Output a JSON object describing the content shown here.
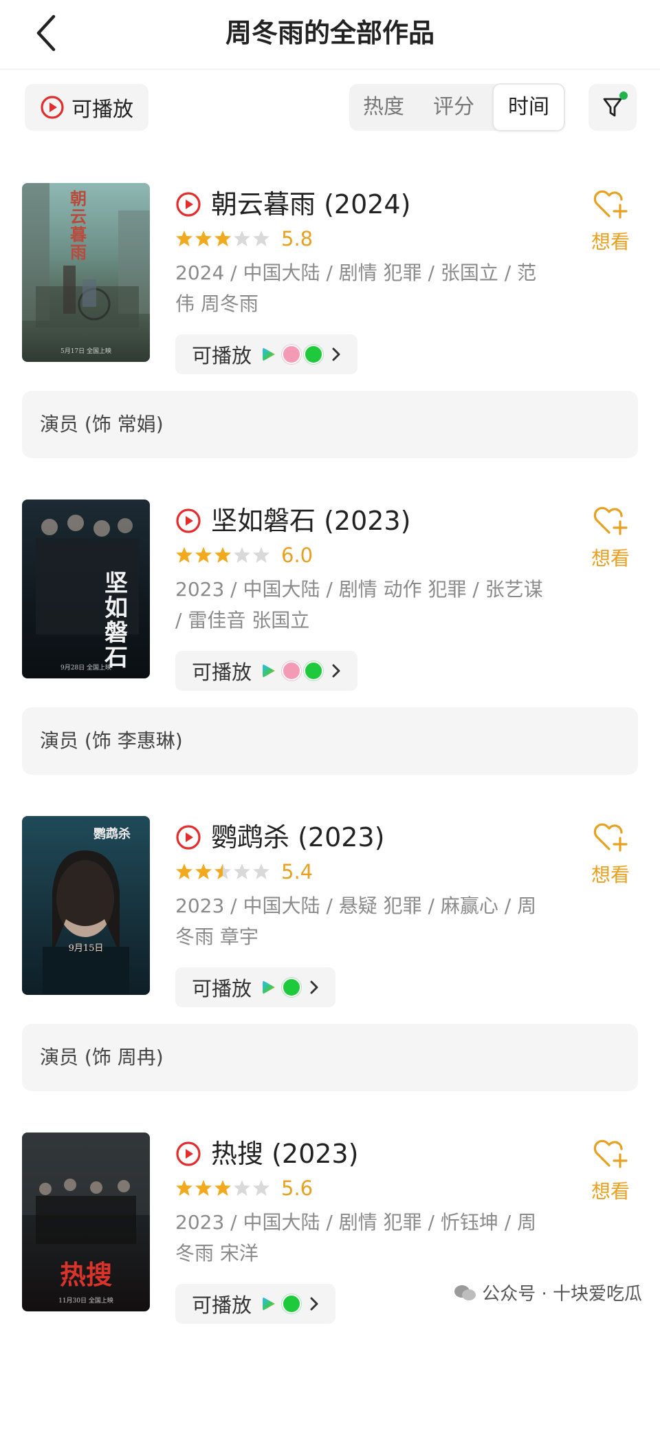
{
  "header": {
    "title": "周冬雨的全部作品",
    "back_icon": "back-chevron-icon"
  },
  "filters": {
    "playable_label": "可播放",
    "sort_options": [
      "热度",
      "评分",
      "时间"
    ],
    "active_sort": "时间",
    "filter_icon": "filter-funnel-icon",
    "filter_badge_color": "#21b34b"
  },
  "colors": {
    "accent": "#e8a020",
    "play_red": "#e32d2d",
    "text_primary": "#222222",
    "text_secondary": "#8a8a8a"
  },
  "films": [
    {
      "title": "朝云暮雨 (2024)",
      "rating": 3,
      "score": "5.8",
      "meta": "2024 / 中国大陆 / 剧情 犯罪 / 张国立 / 范伟 周冬雨",
      "play_label": "可播放",
      "sources": [
        "tencent-video",
        "bilibili",
        "iqiyi"
      ],
      "want_label": "想看",
      "role": "演员 (饰 常娟)"
    },
    {
      "title": "坚如磐石 (2023)",
      "rating": 3,
      "score": "6.0",
      "meta": "2023 / 中国大陆 / 剧情 动作 犯罪 / 张艺谋 / 雷佳音 张国立",
      "play_label": "可播放",
      "sources": [
        "tencent-video",
        "bilibili",
        "iqiyi"
      ],
      "want_label": "想看",
      "role": "演员 (饰 李惠琳)"
    },
    {
      "title": "鹦鹉杀 (2023)",
      "rating": 2.5,
      "score": "5.4",
      "meta": "2023 / 中国大陆 / 悬疑 犯罪 / 麻赢心 / 周冬雨 章宇",
      "play_label": "可播放",
      "sources": [
        "tencent-video",
        "iqiyi"
      ],
      "want_label": "想看",
      "role": "演员 (饰 周冉)"
    },
    {
      "title": "热搜 (2023)",
      "rating": 3,
      "score": "5.6",
      "meta": "2023 / 中国大陆 / 剧情 犯罪 / 忻钰坤 / 周冬雨 宋洋",
      "play_label": "可播放",
      "sources": [
        "tencent-video",
        "iqiyi"
      ],
      "want_label": "想看",
      "role": ""
    }
  ],
  "posters": [
    {
      "title": "朝云暮雨",
      "date": "5月17日 全国上映"
    },
    {
      "title": "坚如磐石",
      "date": "9月28日 全国上映"
    },
    {
      "title": "鹦鹉杀",
      "date": "9月15日"
    },
    {
      "title": "热搜",
      "date": "11月30日 全国上映"
    }
  ],
  "watermark": "公众号 · 十块爱吃瓜"
}
